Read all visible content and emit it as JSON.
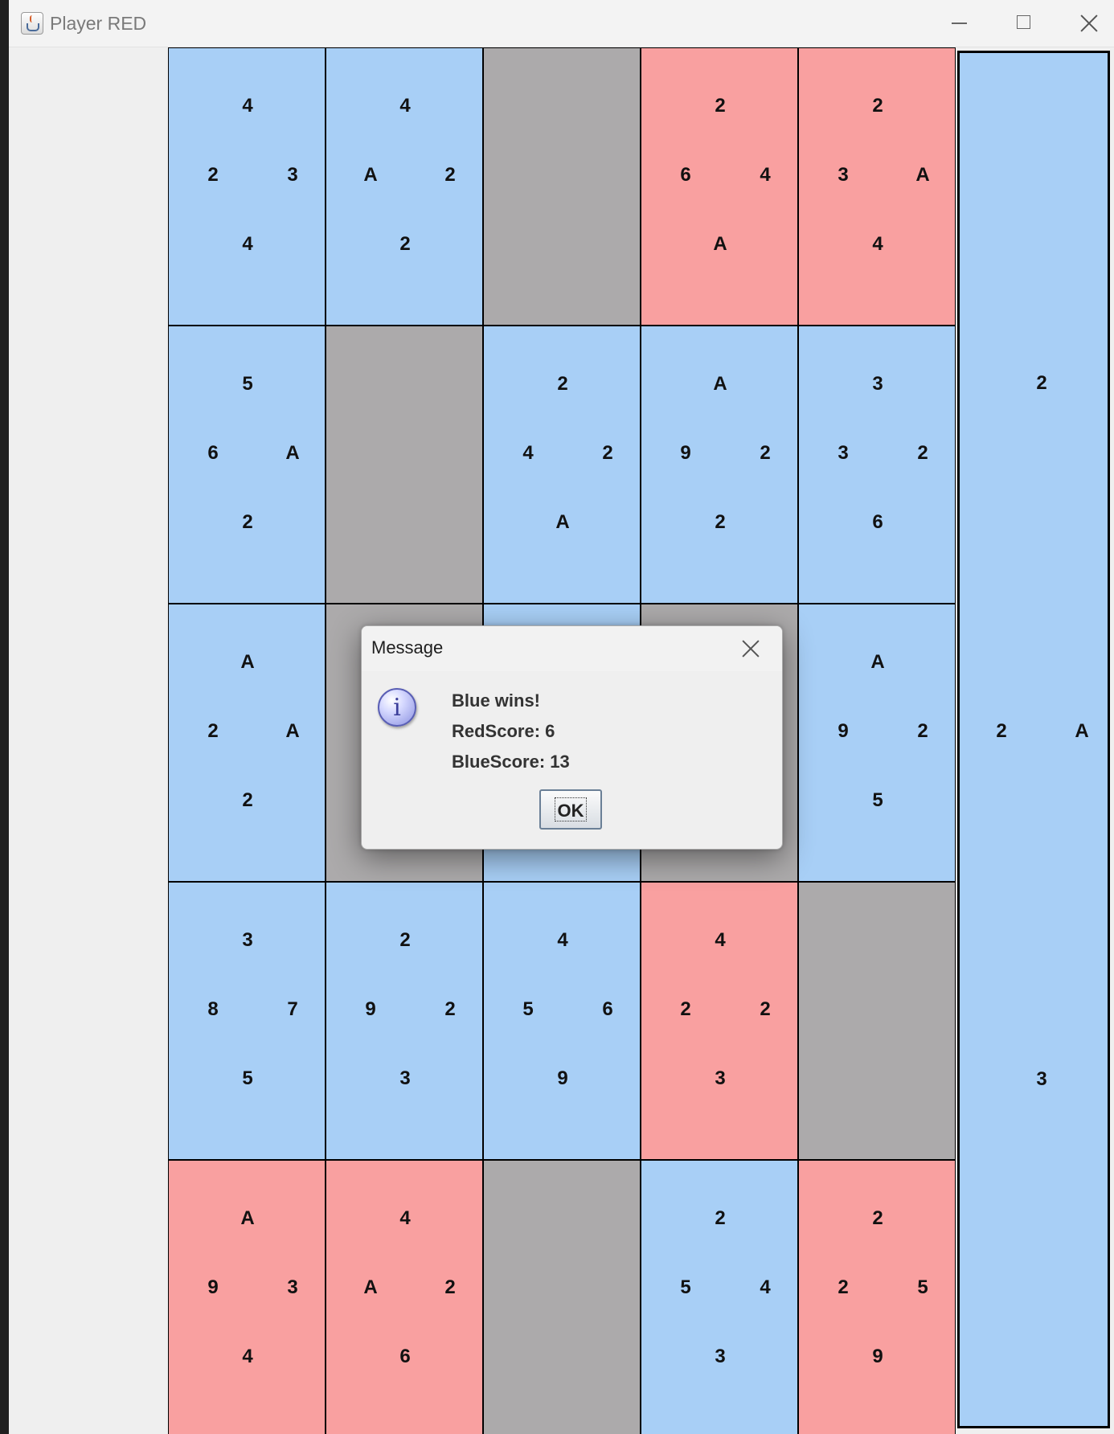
{
  "window": {
    "title": "Player RED",
    "app_icon": "java-cup-icon",
    "controls": [
      "minimize-icon",
      "maximize-icon",
      "close-icon"
    ]
  },
  "board": {
    "rows": [
      [
        {
          "color": "blue",
          "top": "4",
          "left": "2",
          "right": "3",
          "bottom": "4"
        },
        {
          "color": "blue",
          "top": "4",
          "left": "A",
          "right": "2",
          "bottom": "2"
        },
        {
          "color": "empty"
        },
        {
          "color": "red",
          "top": "2",
          "left": "6",
          "right": "4",
          "bottom": "A"
        },
        {
          "color": "red",
          "top": "2",
          "left": "3",
          "right": "A",
          "bottom": "4"
        }
      ],
      [
        {
          "color": "blue",
          "top": "5",
          "left": "6",
          "right": "A",
          "bottom": "2"
        },
        {
          "color": "empty"
        },
        {
          "color": "blue",
          "top": "2",
          "left": "4",
          "right": "2",
          "bottom": "A"
        },
        {
          "color": "blue",
          "top": "A",
          "left": "9",
          "right": "2",
          "bottom": "2"
        },
        {
          "color": "blue",
          "top": "3",
          "left": "3",
          "right": "2",
          "bottom": "6"
        }
      ],
      [
        {
          "color": "blue",
          "top": "A",
          "left": "2",
          "right": "A",
          "bottom": "2"
        },
        {
          "color": "empty"
        },
        {
          "color": "blue"
        },
        {
          "color": "empty"
        },
        {
          "color": "blue",
          "top": "A",
          "left": "9",
          "right": "2",
          "bottom": "5"
        }
      ],
      [
        {
          "color": "blue",
          "top": "3",
          "left": "8",
          "right": "7",
          "bottom": "5"
        },
        {
          "color": "blue",
          "top": "2",
          "left": "9",
          "right": "2",
          "bottom": "3"
        },
        {
          "color": "blue",
          "top": "4",
          "left": "5",
          "right": "6",
          "bottom": "9"
        },
        {
          "color": "red",
          "top": "4",
          "left": "2",
          "right": "2",
          "bottom": "3"
        },
        {
          "color": "empty"
        }
      ],
      [
        {
          "color": "red",
          "top": "A",
          "left": "9",
          "right": "3",
          "bottom": "4"
        },
        {
          "color": "red",
          "top": "4",
          "left": "A",
          "right": "2",
          "bottom": "6"
        },
        {
          "color": "empty"
        },
        {
          "color": "blue",
          "top": "2",
          "left": "5",
          "right": "4",
          "bottom": "3"
        },
        {
          "color": "red",
          "top": "2",
          "left": "2",
          "right": "5",
          "bottom": "9"
        }
      ]
    ]
  },
  "hand": {
    "color": "blue",
    "top": "2",
    "left": "2",
    "right": "A",
    "bottom": "3"
  },
  "colors": {
    "blue": "#a8cff6",
    "red": "#f9a0a0",
    "empty": "#acaaab"
  },
  "dialog": {
    "title": "Message",
    "icon": "info-icon",
    "icon_glyph": "i",
    "lines": [
      "Blue wins!",
      "RedScore: 6",
      "BlueScore: 13"
    ],
    "ok_label": "OK"
  }
}
